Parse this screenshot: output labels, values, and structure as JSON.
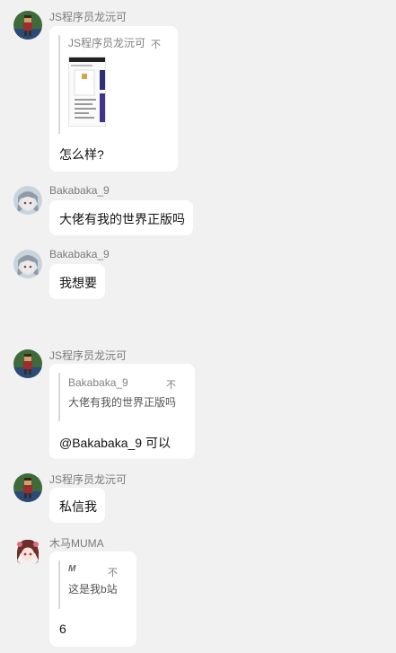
{
  "messages": [
    {
      "sender": "JS程序员龙沅可",
      "quote": {
        "sender": "JS程序员龙沅可",
        "more": "不"
      },
      "text": "怎么样?"
    },
    {
      "sender": "Bakabaka_9",
      "text": "大佬有我的世界正版吗"
    },
    {
      "sender": "Bakabaka_9",
      "text": "我想要"
    },
    {
      "sender": "JS程序员龙沅可",
      "quote": {
        "sender": "Bakabaka_9",
        "more": "不",
        "text": "大佬有我的世界正版吗"
      },
      "text": "@Bakabaka_9 可以"
    },
    {
      "sender": "JS程序员龙沅可",
      "text": "私信我"
    },
    {
      "sender": "木马MUMA",
      "quote": {
        "sender": "M",
        "more": "不",
        "text": "这是我b站"
      },
      "text": "6"
    }
  ],
  "icons": {
    "avatar_js": "pixel-character-avatar-icon",
    "avatar_baka": "anime-girl-avatar-icon",
    "avatar_muma": "anime-girl-brown-hair-avatar-icon",
    "thumbnail": "screenshot-thumbnail-icon"
  },
  "colors": {
    "background": "#f1f1f1",
    "bubble": "#ffffff",
    "name": "#7a7a7a",
    "quote_bar": "#d8d8d8"
  }
}
